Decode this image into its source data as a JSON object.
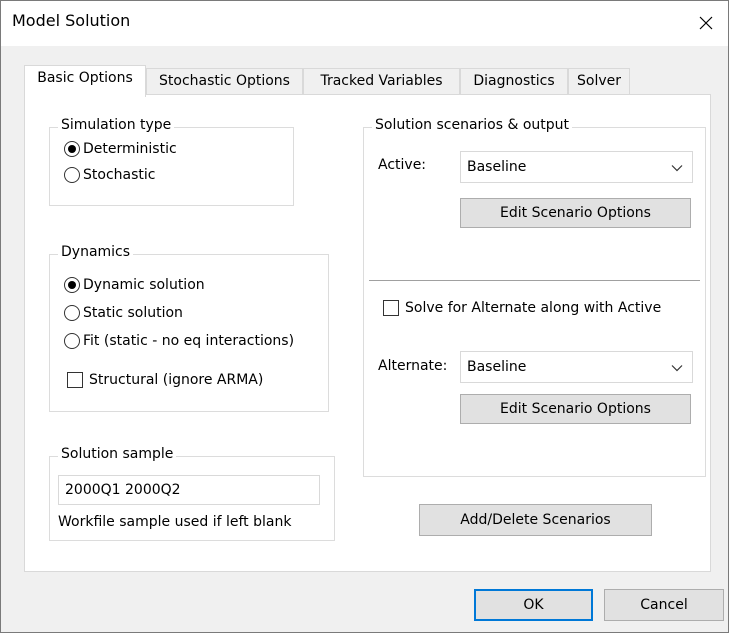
{
  "window": {
    "title": "Model Solution",
    "close_icon": "close-icon"
  },
  "tabs": [
    {
      "label": "Basic Options",
      "active": true
    },
    {
      "label": "Stochastic Options",
      "active": false
    },
    {
      "label": "Tracked Variables",
      "active": false
    },
    {
      "label": "Diagnostics",
      "active": false
    },
    {
      "label": "Solver",
      "active": false
    }
  ],
  "simulation_type": {
    "label": "Simulation type",
    "options": [
      {
        "label": "Deterministic",
        "checked": true
      },
      {
        "label": "Stochastic",
        "checked": false
      }
    ]
  },
  "dynamics": {
    "label": "Dynamics",
    "options": [
      {
        "label": "Dynamic solution",
        "checked": true
      },
      {
        "label": "Static solution",
        "checked": false
      },
      {
        "label": "Fit (static - no eq interactions)",
        "checked": false
      }
    ],
    "structural": {
      "label": "Structural (ignore ARMA)",
      "checked": false
    }
  },
  "solution_sample": {
    "label": "Solution sample",
    "value": "2000Q1 2000Q2",
    "hint": "Workfile sample used if left blank"
  },
  "scenarios": {
    "label": "Solution scenarios & output",
    "active_label": "Active:",
    "active_value": "Baseline",
    "edit_active_button": "Edit Scenario Options",
    "solve_alternate": {
      "label": "Solve for Alternate along with Active",
      "checked": false
    },
    "alternate_label": "Alternate:",
    "alternate_value": "Baseline",
    "edit_alternate_button": "Edit Scenario Options"
  },
  "add_delete_button": "Add/Delete Scenarios",
  "footer": {
    "ok": "OK",
    "cancel": "Cancel"
  },
  "colors": {
    "accent": "#0078d7",
    "button_bg": "#e1e1e1",
    "window_bg": "#f0f0f0"
  }
}
